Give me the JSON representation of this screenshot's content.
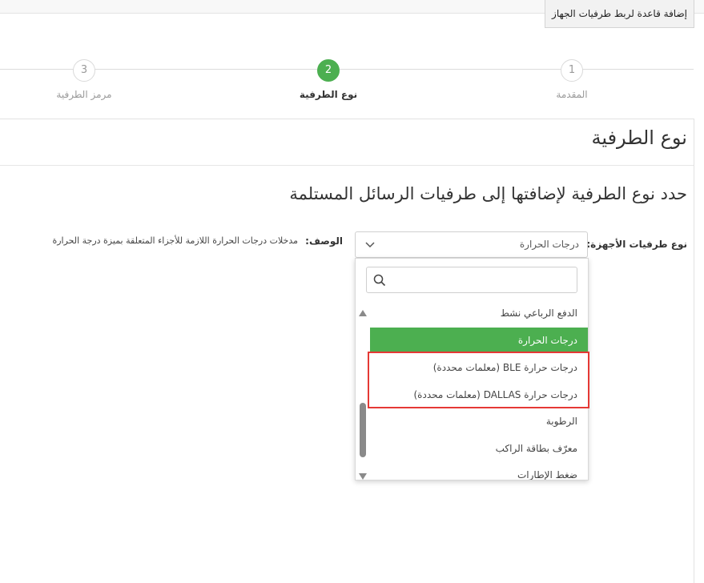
{
  "window": {
    "title": "إضافة قاعدة لربط طرفيات الجهاز"
  },
  "wizard": {
    "steps": [
      {
        "number": "1",
        "label": "المقدمة"
      },
      {
        "number": "2",
        "label": "نوع الطرفية"
      },
      {
        "number": "3",
        "label": "مرمز الطرفية"
      }
    ],
    "active_step": "2"
  },
  "section": {
    "title": "نوع الطرفية",
    "subtitle": "حدد نوع الطرفية لإضافتها إلى طرفيات الرسائل المستلمة"
  },
  "form": {
    "device_peripherals_label": "نوع طرفيات الأجهزة:",
    "selected_value": "درجات الحرارة",
    "description_label": "الوصف:",
    "description_text": "مدخلات درجات الحرارة اللازمة للأجزاء المتعلقة بميزة درجة الحرارة"
  },
  "dropdown": {
    "search_placeholder": "",
    "options": [
      "الدفع الرباعي نشط",
      "درجات الحرارة",
      "درجات حرارة BLE (معلمات محددة)",
      "درجات حرارة DALLAS (معلمات محددة)",
      "الرطوبة",
      "معرّف بطاقة الراكب",
      "ضغط الإطارات"
    ],
    "selected_index": 1,
    "highlighted_indices": [
      2,
      3
    ]
  },
  "colors": {
    "accent": "#4caf50",
    "highlight_border": "#e53935",
    "text": "#333333",
    "muted": "#9a9a9a"
  }
}
